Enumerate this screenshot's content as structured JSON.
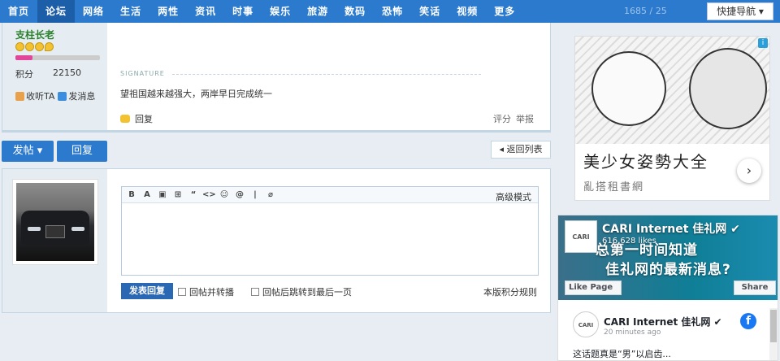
{
  "nav": {
    "items": [
      "首页",
      "论坛",
      "网络",
      "生活",
      "两性",
      "资讯",
      "时事",
      "娱乐",
      "旅游",
      "数码",
      "恐怖",
      "笑话",
      "视频",
      "更多"
    ],
    "active_index": 1,
    "stats": "1685 / 25",
    "quick_nav": "快捷导航 ▾"
  },
  "post": {
    "username": "支柱长老",
    "level_progress": 0.2,
    "points_label": "积分",
    "points_value": "22150",
    "follow_label": "收听TA",
    "message_label": "发消息",
    "signature_label": "SIGNATURE",
    "signature_text": "望祖国越来越强大，两岸早日完成统一",
    "reply_label": "回复",
    "rate_label": "评分",
    "report_label": "举报"
  },
  "actions": {
    "post_label": "发帖 ▾",
    "reply_label": "回复",
    "back_label": "◂ 返回列表"
  },
  "editor": {
    "toolbar": [
      "B",
      "A",
      "▣",
      "⊞",
      "“",
      "<>",
      "☺",
      "@",
      "|",
      "⌀"
    ],
    "advanced_mode": "高级模式",
    "submit_label": "发表回复",
    "option_repost": "回帖并转播",
    "option_jump": "回帖后跳转到最后一页",
    "rules_label": "本版积分规则"
  },
  "ad": {
    "title": "美少女姿勢大全",
    "subtitle": "亂搭租書網",
    "next_icon": "›",
    "badge": "i"
  },
  "facebook": {
    "logo_text": "CARI",
    "page_name": "CARI Internet 佳礼网 ✔",
    "likes": "616,628 likes",
    "cover_text1": "总第一时间知道",
    "cover_text2": "佳礼网的最新消息?",
    "like_button": "Like Page",
    "share_button": "Share",
    "post_name": "CARI Internet 佳礼网 ✔",
    "post_time": "20 minutes ago",
    "fb_icon": "f",
    "post_text": "这话题真是“男”以启齿..."
  },
  "colors": {
    "nav_blue": "#2b7acd",
    "side_bg": "#e5edf2",
    "username_green": "#2a7f2a"
  }
}
